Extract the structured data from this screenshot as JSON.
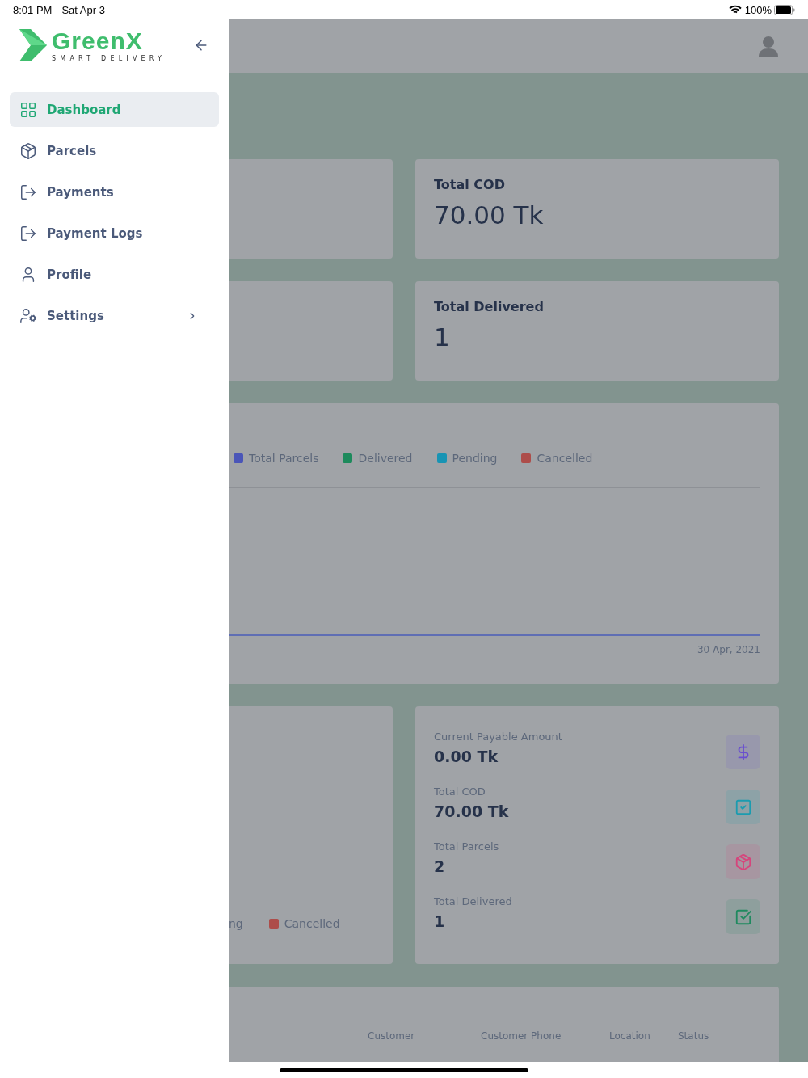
{
  "status_bar": {
    "time": "8:01 PM",
    "date": "Sat Apr 3",
    "battery": "100%"
  },
  "sidebar": {
    "logo": {
      "name": "GreenX",
      "tagline": "SMART DELIVERY"
    },
    "items": [
      {
        "label": "Dashboard",
        "kind": "grid",
        "selected": true
      },
      {
        "label": "Parcels",
        "kind": "box",
        "selected": false
      },
      {
        "label": "Payments",
        "kind": "export",
        "selected": false
      },
      {
        "label": "Payment Logs",
        "kind": "export",
        "selected": false
      },
      {
        "label": "Profile",
        "kind": "user",
        "selected": false
      },
      {
        "label": "Settings",
        "kind": "user-gear",
        "selected": false,
        "has_submenu": true
      }
    ]
  },
  "summary_cards": [
    {
      "label": "Total COD",
      "value": "70.00 Tk"
    },
    {
      "label": "Total Delivered",
      "value": "1"
    }
  ],
  "chart_card": {
    "legend": [
      {
        "label": "Total Parcels",
        "color": "#4a55b8"
      },
      {
        "label": "Delivered",
        "color": "#1d8a5c"
      },
      {
        "label": "Pending",
        "color": "#1894b4"
      },
      {
        "label": "Cancelled",
        "color": "#ad4d4a"
      }
    ],
    "x_label": "30 Apr, 2021"
  },
  "pie_card": {
    "legend": [
      {
        "label": "ng"
      },
      {
        "label": "Cancelled",
        "color": "#ad4d4a"
      }
    ]
  },
  "stats": [
    {
      "label": "Current Payable Amount",
      "value": "0.00 Tk",
      "kind": "dollar",
      "color": "#6a4fcf"
    },
    {
      "label": "Total COD",
      "value": "70.00 Tk",
      "kind": "check",
      "color": "#1a9cb0"
    },
    {
      "label": "Total Parcels",
      "value": "2",
      "kind": "box",
      "color": "#d6457c"
    },
    {
      "label": "Total Delivered",
      "value": "1",
      "kind": "check-square",
      "color": "#1f8a5f"
    }
  ],
  "table": {
    "columns": [
      "Customer",
      "Customer Phone",
      "Location",
      "Status"
    ]
  }
}
